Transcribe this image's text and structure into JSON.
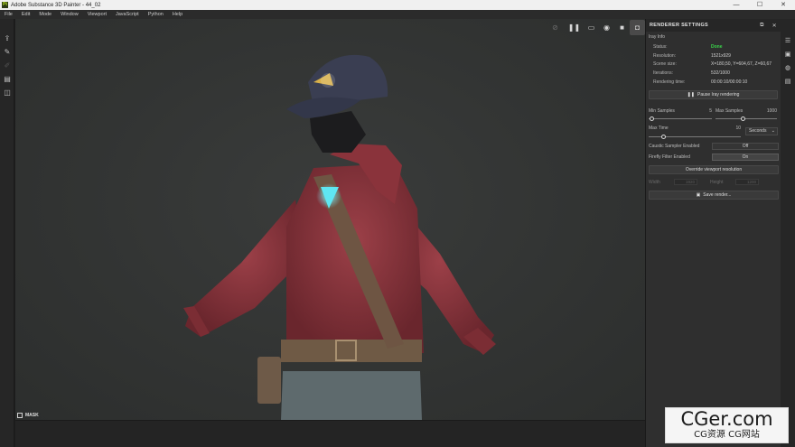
{
  "titlebar": {
    "title": "Adobe Substance 3D Painter - 44_02",
    "logo_text": "Pt",
    "min": "—",
    "max": "☐",
    "close": "✕"
  },
  "menubar": {
    "items": [
      "File",
      "Edit",
      "Mode",
      "Window",
      "Viewport",
      "JavaScript",
      "Python",
      "Help"
    ]
  },
  "left_toolbar": {
    "icons": [
      "import-icon",
      "bake-icon",
      "brush-icon",
      "document-icon",
      "layers-icon"
    ]
  },
  "viewport": {
    "toolbar": [
      "camera-off-icon",
      "pause-icon",
      "frame-icon",
      "render-icon",
      "camera-icon",
      "screenshot-icon"
    ],
    "mask_label": "MASK"
  },
  "panel": {
    "title": "RENDERER SETTINGS",
    "section": "Iray Info",
    "info": [
      {
        "key": "Status:",
        "value": "Done"
      },
      {
        "key": "Resolution:",
        "value": "1521x929"
      },
      {
        "key": "Scene size:",
        "value": "X=180,50, Y=604,67, Z=60,67"
      },
      {
        "key": "Iterations:",
        "value": "532/1000"
      },
      {
        "key": "Rendering time:",
        "value": "00:00:10/00:00:10"
      }
    ],
    "pause_button": "Pause Iray rendering",
    "min_samples": {
      "label": "Min Samples",
      "value": "5"
    },
    "max_samples": {
      "label": "Max Samples",
      "value": "1000"
    },
    "max_time": {
      "label": "Max Time",
      "value": "10",
      "unit": "Seconds"
    },
    "caustic": {
      "label": "Caustic Sampler Enabled",
      "value": "Off"
    },
    "firefly": {
      "label": "Firefly Filter Enabled",
      "value": "On"
    },
    "override_button": "Override viewport resolution",
    "width": {
      "label": "Width",
      "value": "1920"
    },
    "height": {
      "label": "Height",
      "value": "1200"
    },
    "save_button": "Save render..."
  },
  "right_iconbar": {
    "icons": [
      "layers-stack-icon",
      "chat-icon",
      "globe-icon",
      "list-icon"
    ]
  },
  "watermark": {
    "line1": "CGer.com",
    "line2": "CG资源 CG网站"
  },
  "colors": {
    "accent_done": "#3ad24a",
    "background": "#1e1e1e",
    "panel": "#2f2f2f",
    "hoodie": "#8f3a40"
  }
}
